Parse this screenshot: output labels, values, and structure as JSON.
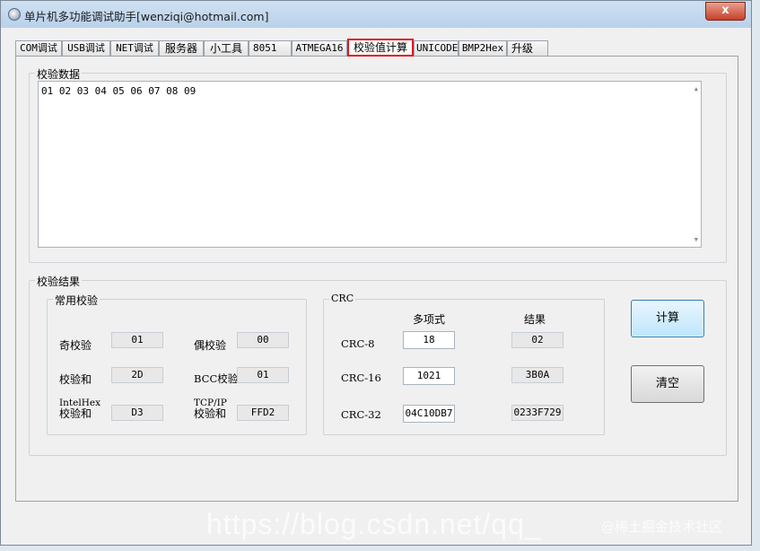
{
  "window": {
    "title": "单片机多功能调试助手[wenziqi@hotmail.com]",
    "close_label": "x"
  },
  "tabs": [
    "COM调试",
    "USB调试",
    "NET调试",
    "服务器",
    "小工具",
    "8051",
    "ATMEGA16",
    "校验值计算",
    "UNICODE",
    "BMP2Hex",
    "升级"
  ],
  "data_group": {
    "label": "校验数据",
    "content": "01 02 03 04 05 06 07 08 09"
  },
  "result_group": {
    "label": "校验结果"
  },
  "common": {
    "label": "常用校验",
    "odd_label": "奇校验",
    "odd_value": "01",
    "even_label": "偶校验",
    "even_value": "00",
    "sum_label": "校验和",
    "sum_value": "2D",
    "bcc_label": "BCC校验",
    "bcc_value": "01",
    "intelhex_label_1": "IntelHex",
    "intelhex_label_2": "校验和",
    "intelhex_value": "D3",
    "tcpip_label_1": "TCP/IP",
    "tcpip_label_2": "校验和",
    "tcpip_value": "FFD2"
  },
  "crc": {
    "label": "CRC",
    "poly_header": "多项式",
    "result_header": "结果",
    "rows": [
      {
        "name": "CRC-8",
        "poly": "18",
        "result": "02"
      },
      {
        "name": "CRC-16",
        "poly": "1021",
        "result": "3B0A"
      },
      {
        "name": "CRC-32",
        "poly": "04C10DB7",
        "result": "0233F729"
      }
    ]
  },
  "buttons": {
    "calc": "计算",
    "clear": "清空"
  },
  "watermark": {
    "url": "https://blog.csdn.net/qq_",
    "site": "@稀土掘金技术社区"
  }
}
